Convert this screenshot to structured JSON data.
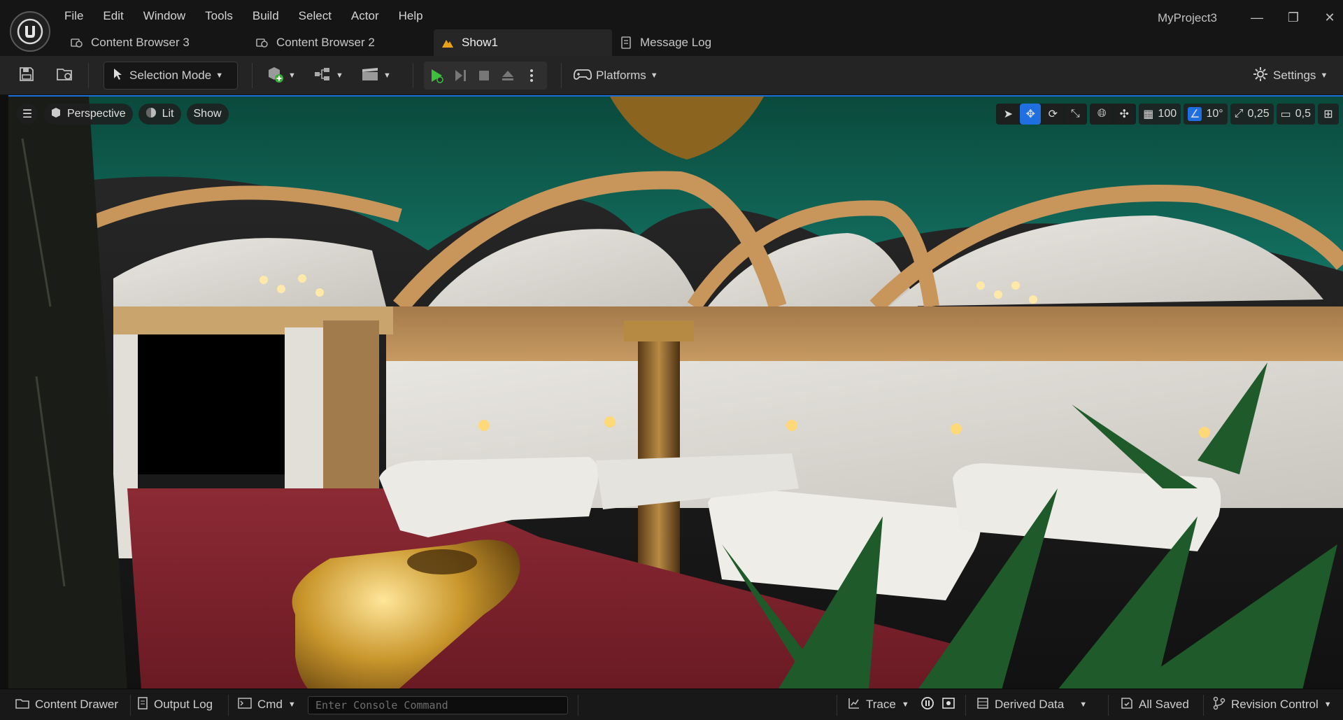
{
  "app": {
    "project_name": "MyProject3",
    "menu": [
      "File",
      "Edit",
      "Window",
      "Tools",
      "Build",
      "Select",
      "Actor",
      "Help"
    ],
    "window_controls": {
      "minimize": "—",
      "restore": "❐",
      "close": "✕"
    }
  },
  "tabs": [
    {
      "label": "Content Browser 3",
      "icon": "content-browser-icon",
      "active": false
    },
    {
      "label": "Content Browser 2",
      "icon": "content-browser-icon",
      "active": false
    },
    {
      "label": "Show1",
      "icon": "level-icon",
      "active": true
    },
    {
      "label": "Message Log",
      "icon": "message-log-icon",
      "active": false
    }
  ],
  "toolbar": {
    "mode_label": "Selection Mode",
    "platforms_label": "Platforms",
    "settings_label": "Settings"
  },
  "viewport": {
    "view_mode": "Perspective",
    "lighting": "Lit",
    "show_label": "Show",
    "grid_snap": "100",
    "rotation_snap": "10°",
    "scale_snap": "0,25",
    "camera_speed": "0,5"
  },
  "statusbar": {
    "content_drawer": "Content Drawer",
    "output_log": "Output Log",
    "cmd_label": "Cmd",
    "console_placeholder": "Enter Console Command",
    "trace_label": "Trace",
    "derived_data_label": "Derived Data",
    "save_status": "All Saved",
    "revision_control": "Revision Control"
  },
  "colors": {
    "accent": "#1f6fe0",
    "play_green": "#3fbf3f",
    "ceiling_green": "#0d5a4b",
    "carpet_red": "#7a1f2b",
    "gold": "#c9962c"
  }
}
